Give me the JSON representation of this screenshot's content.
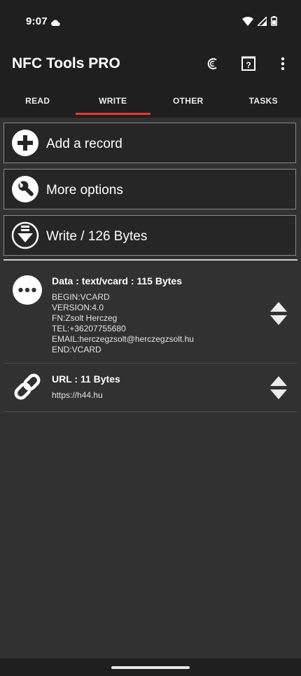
{
  "status": {
    "time": "9:07"
  },
  "app": {
    "title": "NFC Tools PRO"
  },
  "tabs": [
    {
      "label": "READ",
      "active": false
    },
    {
      "label": "WRITE",
      "active": true
    },
    {
      "label": "OTHER",
      "active": false
    },
    {
      "label": "TASKS",
      "active": false
    }
  ],
  "actions": {
    "add_record": "Add a record",
    "more_options": "More options",
    "write": "Write / 126 Bytes"
  },
  "records": [
    {
      "title": "Data : text/vcard : 115 Bytes",
      "lines": [
        "BEGIN:VCARD",
        "VERSION:4.0",
        "FN:Zsolt Herczeg",
        "TEL:+36207755680",
        "EMAIL:herczegzsolt@herczegzsolt.hu",
        "END:VCARD"
      ],
      "icon": "more-dots-icon"
    },
    {
      "title": "URL : 11 Bytes",
      "lines": [
        "https://h44.hu"
      ],
      "icon": "link-icon"
    }
  ],
  "colors": {
    "accent": "#e53935",
    "background": "#313131",
    "bar": "#1f1f1f"
  }
}
